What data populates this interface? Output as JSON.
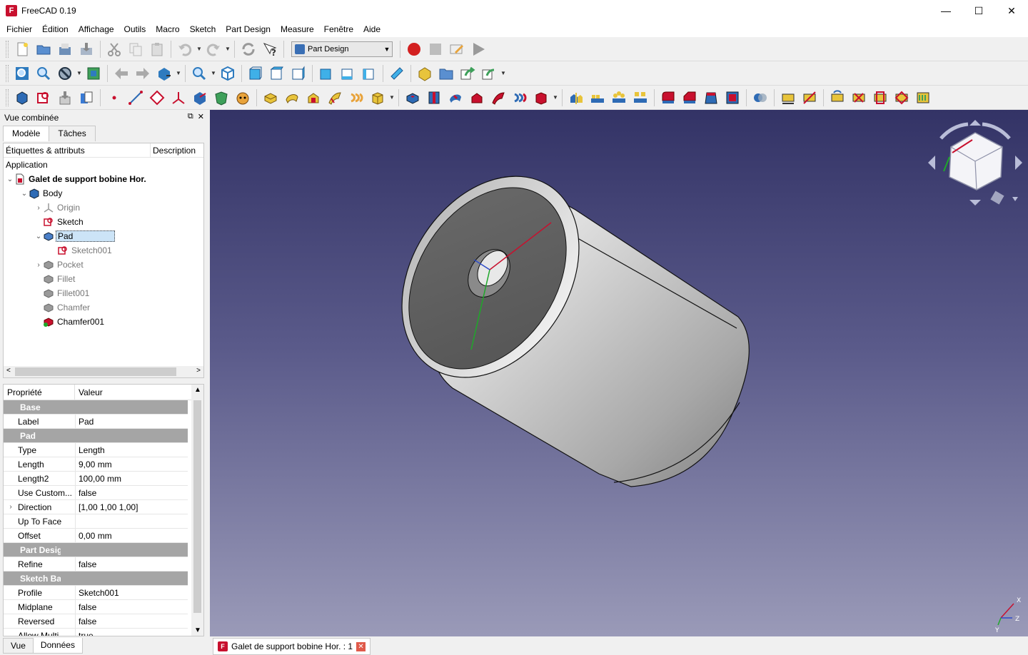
{
  "window": {
    "title": "FreeCAD 0.19",
    "minimize": "—",
    "maximize": "☐",
    "close": "✕"
  },
  "menu": [
    "Fichier",
    "Édition",
    "Affichage",
    "Outils",
    "Macro",
    "Sketch",
    "Part Design",
    "Measure",
    "Fenêtre",
    "Aide"
  ],
  "workbench_selector": {
    "value": "Part Design"
  },
  "combo_view": {
    "title": "Vue combinée",
    "tabs": [
      "Modèle",
      "Tâches"
    ],
    "tree_headers": [
      "Étiquettes & attributs",
      "Description"
    ],
    "root_label": "Application",
    "tree": [
      {
        "label": "Galet de support bobine Hor.",
        "level": 0,
        "twisty": "v",
        "icon": "document-icon",
        "style": "bold"
      },
      {
        "label": "Body",
        "level": 1,
        "twisty": "v",
        "icon": "body-icon",
        "style": "normal"
      },
      {
        "label": "Origin",
        "level": 2,
        "twisty": ">",
        "icon": "origin-icon",
        "style": "dim"
      },
      {
        "label": "Sketch",
        "level": 2,
        "twisty": "",
        "icon": "sketch-icon",
        "style": "normal"
      },
      {
        "label": "Pad",
        "level": 2,
        "twisty": "v",
        "icon": "pad-icon",
        "style": "selected"
      },
      {
        "label": "Sketch001",
        "level": 3,
        "twisty": "",
        "icon": "sketch-icon",
        "style": "dim"
      },
      {
        "label": "Pocket",
        "level": 2,
        "twisty": ">",
        "icon": "pocket-icon",
        "style": "dim"
      },
      {
        "label": "Fillet",
        "level": 2,
        "twisty": "",
        "icon": "fillet-icon",
        "style": "dim"
      },
      {
        "label": "Fillet001",
        "level": 2,
        "twisty": "",
        "icon": "fillet-icon",
        "style": "dim"
      },
      {
        "label": "Chamfer",
        "level": 2,
        "twisty": "",
        "icon": "chamfer-icon",
        "style": "dim"
      },
      {
        "label": "Chamfer001",
        "level": 2,
        "twisty": "",
        "icon": "chamfer-active-icon",
        "style": "normal"
      }
    ],
    "property_headers": [
      "Propriété",
      "Valeur"
    ],
    "properties": [
      {
        "group": "Base"
      },
      {
        "name": "Label",
        "value": "Pad"
      },
      {
        "group": "Pad"
      },
      {
        "name": "Type",
        "value": "Length"
      },
      {
        "name": "Length",
        "value": "9,00 mm"
      },
      {
        "name": "Length2",
        "value": "100,00 mm"
      },
      {
        "name": "Use Custom...",
        "value": "false"
      },
      {
        "name": "Direction",
        "value": "[1,00 1,00 1,00]",
        "expandable": true
      },
      {
        "name": "Up To Face",
        "value": ""
      },
      {
        "name": "Offset",
        "value": "0,00 mm"
      },
      {
        "group": "Part Design"
      },
      {
        "name": "Refine",
        "value": "false"
      },
      {
        "group": "Sketch Based"
      },
      {
        "name": "Profile",
        "value": "Sketch001"
      },
      {
        "name": "Midplane",
        "value": "false"
      },
      {
        "name": "Reversed",
        "value": "false"
      },
      {
        "name": "Allow Multi...",
        "value": "true"
      }
    ],
    "bottom_tabs": [
      "Vue",
      "Données"
    ]
  },
  "document_tab": {
    "label": "Galet de support bobine Hor. : 1"
  },
  "axis_labels": {
    "x": "X",
    "y": "Y",
    "z": "Z"
  },
  "colors": {
    "selection": "#cce4f7",
    "group_row": "#a5a5a5",
    "view_top": "#333366",
    "view_bottom": "#9a9ab8",
    "record_red": "#d32020"
  }
}
